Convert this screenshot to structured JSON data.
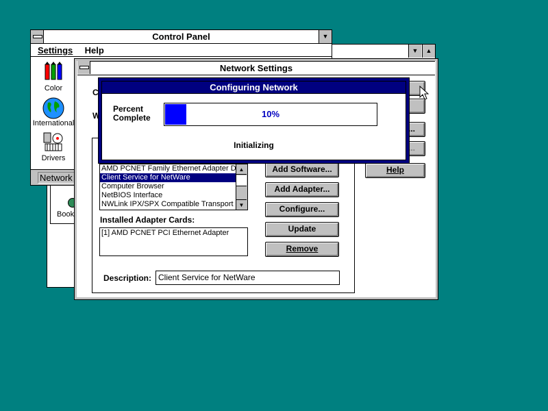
{
  "control_panel": {
    "title": "Control Panel",
    "menu": [
      "Settings",
      "Help"
    ],
    "icons": [
      {
        "label": "Color",
        "icon": "color-pencils-icon"
      },
      {
        "label": "International",
        "icon": "globe-icon"
      },
      {
        "label": "Drivers",
        "icon": "drivers-icon"
      }
    ],
    "status_text": "Network"
  },
  "back_window": {
    "icon_label": "Book"
  },
  "network_settings": {
    "title": "Network Settings",
    "network_components": [
      "AMD PCNET Family Ethernet Adapter Dri",
      "Client Service for NetWare",
      "Computer Browser",
      "NetBIOS Interface",
      "NWLink IPX/SPX Compatible Transport"
    ],
    "selected_component_index": 1,
    "installed_adapters_label": "Installed Adapter Cards:",
    "installed_adapters": [
      "[1] AMD PCNET PCI Ethernet Adapter"
    ],
    "description_label": "Description:",
    "description_value": "Client Service for NetWare",
    "buttons": {
      "add_software": "Add Software...",
      "add_adapter": "Add Adapter...",
      "configure": "Configure...",
      "update": "Update",
      "remove": "Remove",
      "help": "Help"
    },
    "partial_labels": {
      "c": "C",
      "w": "W"
    },
    "right_button_fragments": {
      "b3": "...",
      "b4": "..."
    }
  },
  "progress_dialog": {
    "title": "Configuring Network",
    "percent_label_line1": "Percent",
    "percent_label_line2": "Complete",
    "percent_text": "10%",
    "progress_fraction": 0.1,
    "status": "Initializing"
  },
  "colors": {
    "desktop": "#008080",
    "title_active": "#000080",
    "progress_fill": "#0000ff"
  }
}
